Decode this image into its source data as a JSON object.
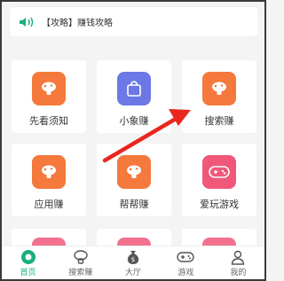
{
  "notice": {
    "text": "【攻略】赚钱攻略"
  },
  "grid": [
    {
      "label": "先看须知",
      "icon": "mushroom-icon",
      "color": "#f5793c"
    },
    {
      "label": "小象赚",
      "icon": "shopping-bag-icon",
      "color": "#6b78e5"
    },
    {
      "label": "搜索赚",
      "icon": "mushroom-icon",
      "color": "#f5793c"
    },
    {
      "label": "应用赚",
      "icon": "mushroom-icon",
      "color": "#f5793c"
    },
    {
      "label": "帮帮赚",
      "icon": "mushroom-icon",
      "color": "#f5793c"
    },
    {
      "label": "爱玩游戏",
      "icon": "gamepad-icon",
      "color": "#f0577a"
    }
  ],
  "tabs": [
    {
      "label": "首页",
      "icon": "home-icon",
      "active": true
    },
    {
      "label": "搜索赚",
      "icon": "mushroom-icon",
      "active": false
    },
    {
      "label": "大厅",
      "icon": "money-bag-icon",
      "active": false
    },
    {
      "label": "游戏",
      "icon": "gamepad-icon",
      "active": false
    },
    {
      "label": "我的",
      "icon": "user-icon",
      "active": false
    }
  ],
  "colors": {
    "accent": "#19b07a",
    "arrow": "#e8261d"
  }
}
